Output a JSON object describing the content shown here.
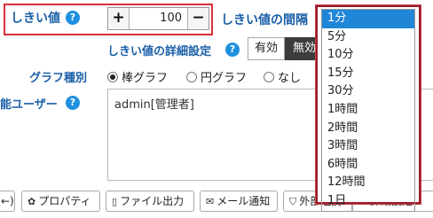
{
  "threshold": {
    "label": "しきい値",
    "help_icon": "?",
    "step_left": "+",
    "value": "100",
    "step_right": "−"
  },
  "interval": {
    "label": "しきい値の間隔"
  },
  "detail": {
    "label": "しきい値の詳細設定",
    "help_icon": "?",
    "enabled_label": "有効",
    "disabled_label": "無効"
  },
  "graph": {
    "label": "グラフ種別",
    "options": [
      "棒グラフ",
      "円グラフ",
      "なし"
    ],
    "selected": "棒グラフ"
  },
  "users": {
    "label": "能ユーザー",
    "help_icon": "?",
    "value": "admin[管理者]"
  },
  "toolbar": {
    "prev_label": "←)",
    "properties_label": "プロパティ",
    "file_output_label": "ファイル出力",
    "mail_label": "メール通知",
    "external_label": "外部連携",
    "detail_label": "詳細設定"
  },
  "interval_dropdown": {
    "options": [
      "1分",
      "5分",
      "10分",
      "15分",
      "30分",
      "1時間",
      "2時間",
      "3時間",
      "6時間",
      "12時間",
      "1日"
    ],
    "selected": "1分"
  },
  "colors": {
    "accent_blue": "#1a5fa8",
    "help_blue": "#1e90e0",
    "highlight_red": "#d9303a",
    "selection_blue": "#1f86d8"
  }
}
